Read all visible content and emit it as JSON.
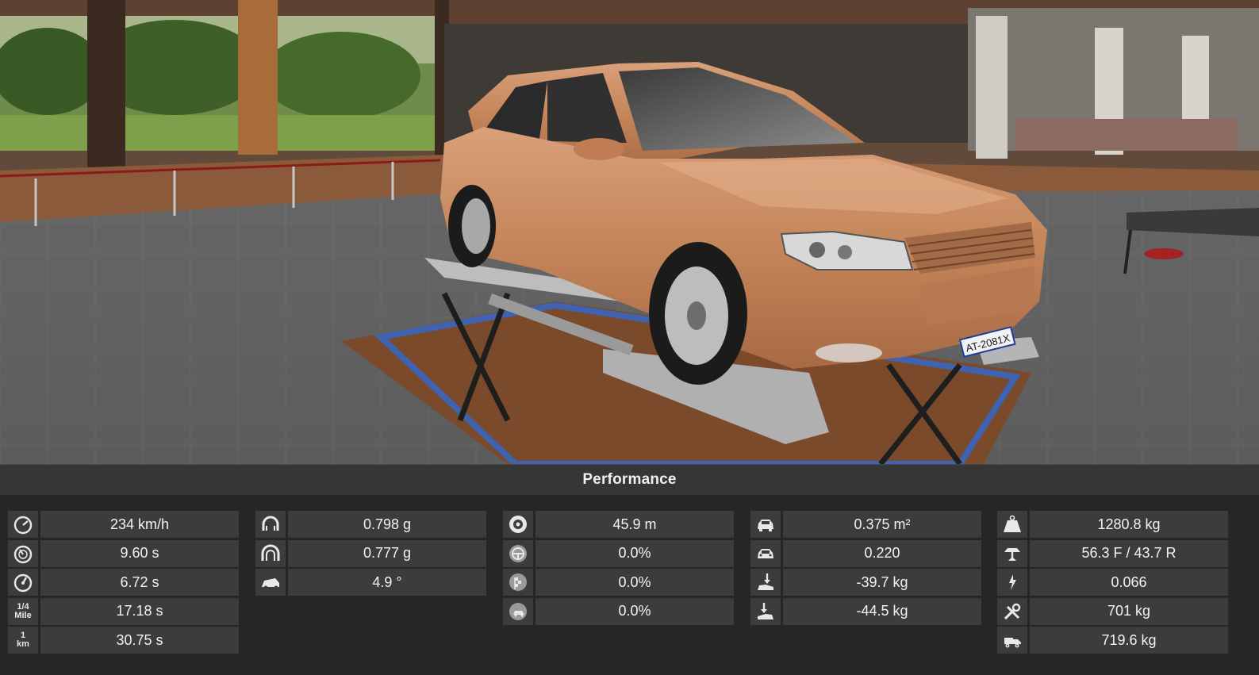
{
  "panel": {
    "title": "Performance",
    "columns": [
      {
        "rows": [
          {
            "icon": "speedometer-icon",
            "value": "234 km/h"
          },
          {
            "icon": "gauge-icon",
            "value": "9.60 s"
          },
          {
            "icon": "gauge-alt-icon",
            "value": "6.72 s"
          },
          {
            "icon": "quarter-mile-icon",
            "icon_text": [
              "1/4",
              "Mile"
            ],
            "value": "17.18 s"
          },
          {
            "icon": "one-km-icon",
            "icon_text": [
              "1",
              "km"
            ],
            "value": "30.75 s"
          }
        ]
      },
      {
        "rows": [
          {
            "icon": "horseshoe-icon",
            "value": "0.798 g"
          },
          {
            "icon": "horseshoe-alt-icon",
            "value": "0.777 g"
          },
          {
            "icon": "car-tilt-icon",
            "value": "4.9 °"
          }
        ]
      },
      {
        "rows": [
          {
            "icon": "brake-disc-icon",
            "value": "45.9 m"
          },
          {
            "icon": "steering-wheel-icon",
            "value": "0.0%"
          },
          {
            "icon": "race-flag-icon",
            "value": "0.0%"
          },
          {
            "icon": "car-badge-icon",
            "value": "0.0%"
          }
        ]
      },
      {
        "rows": [
          {
            "icon": "car-front-area-icon",
            "value": "0.375 m²"
          },
          {
            "icon": "car-front-drag-icon",
            "value": "0.220"
          },
          {
            "icon": "downforce-front-icon",
            "value": "-39.7 kg"
          },
          {
            "icon": "downforce-rear-icon",
            "value": "-44.5 kg"
          }
        ]
      },
      {
        "rows": [
          {
            "icon": "weight-icon",
            "value": "1280.8 kg"
          },
          {
            "icon": "weight-distribution-icon",
            "value": "56.3 F / 43.7 R"
          },
          {
            "icon": "lightning-icon",
            "value": "0.066"
          },
          {
            "icon": "tools-icon",
            "value": "701 kg"
          },
          {
            "icon": "tow-truck-icon",
            "value": "719.6 kg"
          }
        ]
      }
    ]
  },
  "scene": {
    "license_plate": "AT-2081X",
    "car_color": "#c98a62"
  }
}
